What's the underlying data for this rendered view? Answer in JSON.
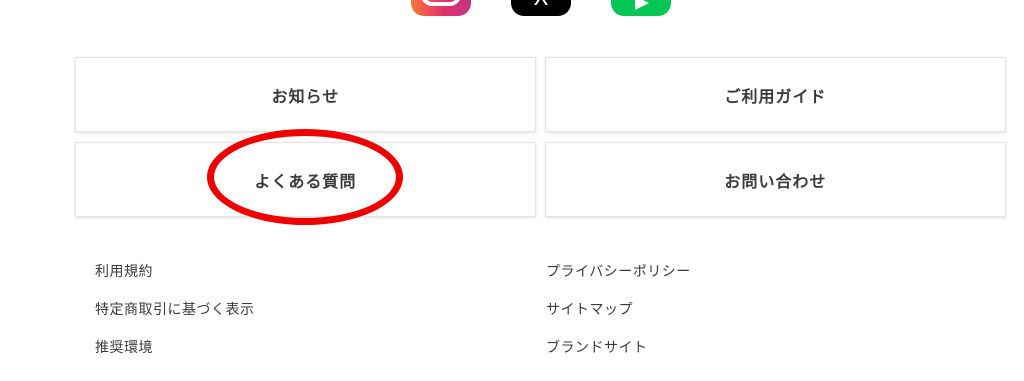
{
  "social": {
    "icons": [
      "instagram-icon",
      "x-icon",
      "line-icon"
    ],
    "x_glyph": "X",
    "colors": {
      "instagram": "#e1306c",
      "x": "#000000",
      "line": "#06c755"
    }
  },
  "nav": {
    "news": "お知らせ",
    "guide": "ご利用ガイド",
    "faq": "よくある質問",
    "contact": "お問い合わせ"
  },
  "footer": {
    "left": [
      "利用規約",
      "特定商取引に基づく表示",
      "推奨環境"
    ],
    "right": [
      "プライバシーポリシー",
      "サイトマップ",
      "ブランドサイト"
    ]
  },
  "annotation": {
    "color": "#ee0000",
    "target": "faq"
  }
}
